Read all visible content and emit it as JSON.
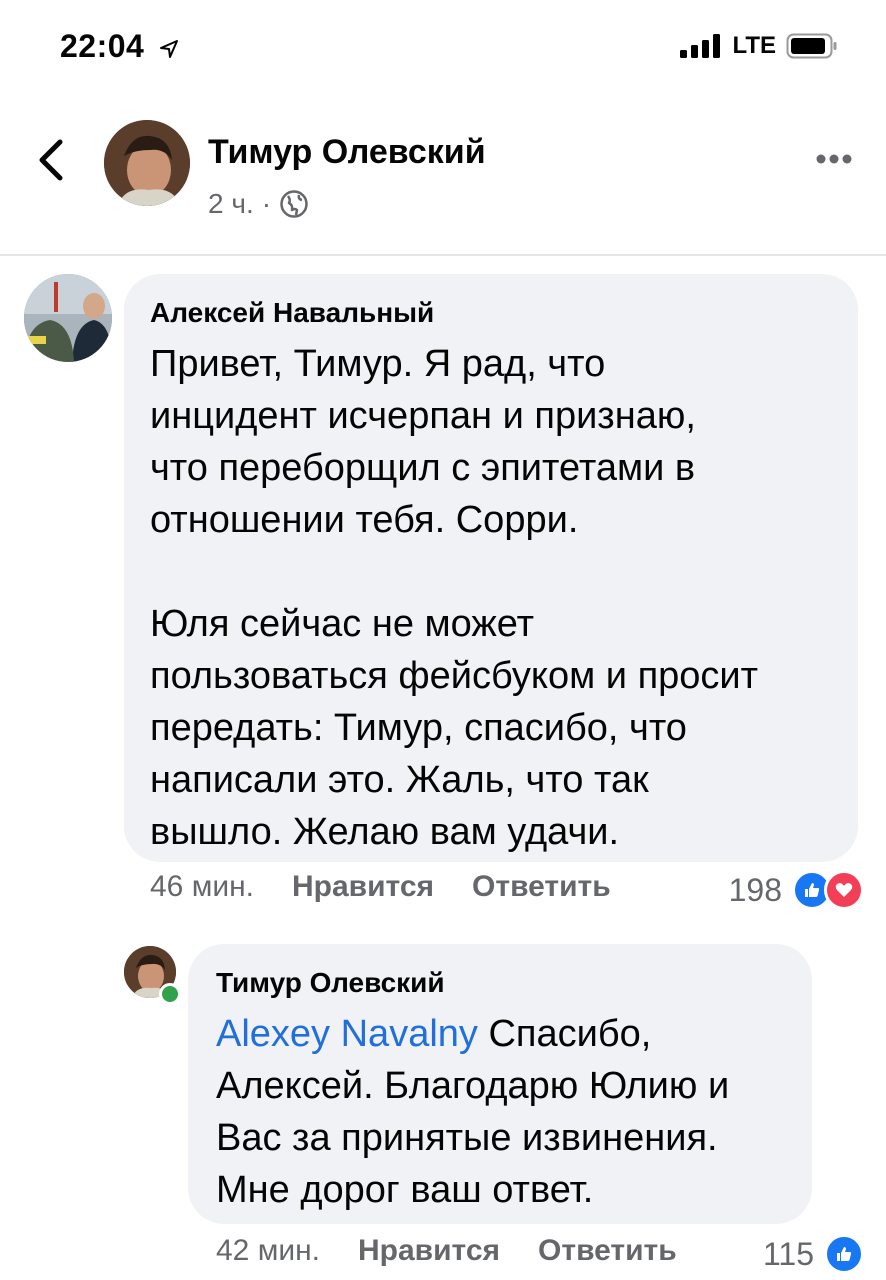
{
  "status_bar": {
    "time": "22:04",
    "network": "LTE"
  },
  "post": {
    "author": "Тимур Олевский",
    "time": "2 ч.",
    "separator": "·"
  },
  "comments": [
    {
      "author": "Алексей Навальный",
      "text": "Привет, Тимур. Я рад, что\nинцидент исчерпан и признаю,\nчто переборщил с эпитетами в\nотношении тебя. Сорри.\n\nЮля сейчас не может\nпользоваться фейсбуком и просит\nпередать: Тимур, спасибо, что\nнаписали это. Жаль, что так\nвышло. Желаю вам удачи.",
      "time": "46 мин.",
      "like_label": "Нравится",
      "reply_label": "Ответить",
      "reactions": "198"
    },
    {
      "author": "Тимур Олевский",
      "mention": "Alexey Navalny",
      "text": " Спасибо,\nАлексей. Благодарю Юлию и\nВас за принятые извинения.\nМне дорог ваш ответ.",
      "time": "42 мин.",
      "like_label": "Нравится",
      "reply_label": "Ответить",
      "reactions": "115"
    }
  ],
  "colors": {
    "link": "#216fdb",
    "bubble": "#f0f2f5",
    "muted": "#65676b",
    "like": "#1877f2",
    "love": "#f33e58",
    "online": "#31a24c"
  },
  "icons": [
    "location-arrow-icon",
    "signal-icon",
    "battery-icon",
    "back-chevron-icon",
    "globe-icon",
    "more-icon",
    "like-icon",
    "love-icon"
  ]
}
